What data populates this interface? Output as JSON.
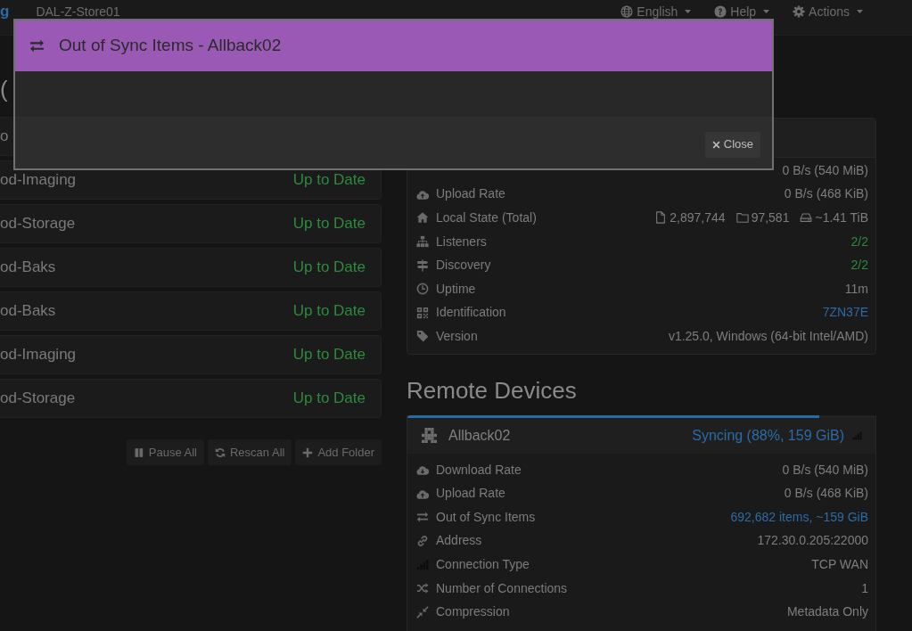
{
  "navbar": {
    "brand": "g",
    "device_name": "DAL-Z-Store01",
    "menus": [
      {
        "label": "English"
      },
      {
        "label": "Help"
      },
      {
        "label": "Actions"
      }
    ]
  },
  "folders": {
    "heading": "(",
    "rows": [
      {
        "name": "o"
      },
      {
        "name": "od-Imaging",
        "status": "Up to Date"
      },
      {
        "name": "od-Storage",
        "status": "Up to Date"
      },
      {
        "name": "od-Baks",
        "status": "Up to Date"
      },
      {
        "name": "od-Baks",
        "status": "Up to Date"
      },
      {
        "name": "od-Imaging",
        "status": "Up to Date"
      },
      {
        "name": "od-Storage",
        "status": "Up to Date"
      }
    ],
    "buttons": [
      "Pause All",
      "Rescan All",
      "Add Folder"
    ]
  },
  "this_device": {
    "rows": [
      {
        "kind": "text",
        "value": "0 B/s (540 MiB)"
      },
      {
        "label": "Upload Rate",
        "kind": "text",
        "value": "0 B/s (468 KiB)"
      },
      {
        "label": "Local State (Total)",
        "kind": "counts",
        "values": [
          "2,897,744",
          "97,581",
          "~1.41 TiB"
        ]
      },
      {
        "label": "Listeners",
        "kind": "success",
        "value": "2/2"
      },
      {
        "label": "Discovery",
        "kind": "success",
        "value": "2/2"
      },
      {
        "label": "Uptime",
        "kind": "text",
        "value": "11m"
      },
      {
        "label": "Identification",
        "kind": "link",
        "value": "7ZN37E"
      },
      {
        "label": "Version",
        "kind": "text",
        "value": "v1.25.0, Windows (64-bit Intel/AMD)"
      }
    ]
  },
  "remote_devices": {
    "heading": "Remote Devices",
    "devices": [
      {
        "name": "Allback02",
        "status": "Syncing (88%, 159 GiB)",
        "level": 0.88,
        "rows": [
          {
            "label": "Download Rate",
            "kind": "text",
            "value": "0 B/s (540 MiB)"
          },
          {
            "label": "Upload Rate",
            "kind": "text",
            "value": "0 B/s (468 KiB)"
          },
          {
            "label": "Out of Sync Items",
            "kind": "link",
            "value": "692,682 items, ~159 GiB"
          },
          {
            "label": "Address",
            "kind": "text",
            "value": "172.30.0.205:22000"
          },
          {
            "label": "Connection Type",
            "kind": "text",
            "value": "TCP WAN"
          },
          {
            "label": "Number of Connections",
            "kind": "text",
            "value": "1"
          },
          {
            "label": "Compression",
            "kind": "text",
            "value": "Metadata Only"
          }
        ]
      }
    ]
  },
  "modal": {
    "title": "Out of Sync Items - Allback02",
    "close_button": "Close"
  }
}
